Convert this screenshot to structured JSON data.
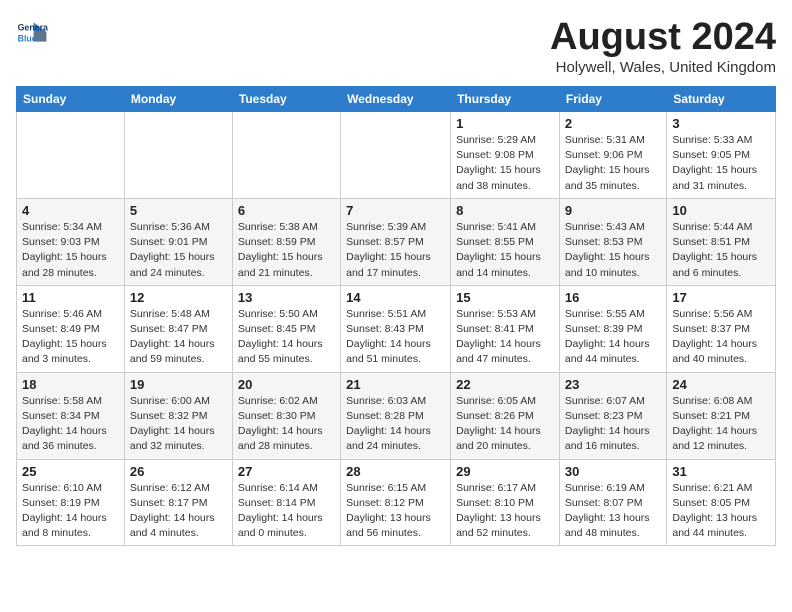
{
  "logo": {
    "line1": "General",
    "line2": "Blue"
  },
  "title": "August 2024",
  "location": "Holywell, Wales, United Kingdom",
  "days_of_week": [
    "Sunday",
    "Monday",
    "Tuesday",
    "Wednesday",
    "Thursday",
    "Friday",
    "Saturday"
  ],
  "weeks": [
    [
      {
        "day": "",
        "info": ""
      },
      {
        "day": "",
        "info": ""
      },
      {
        "day": "",
        "info": ""
      },
      {
        "day": "",
        "info": ""
      },
      {
        "day": "1",
        "info": "Sunrise: 5:29 AM\nSunset: 9:08 PM\nDaylight: 15 hours\nand 38 minutes."
      },
      {
        "day": "2",
        "info": "Sunrise: 5:31 AM\nSunset: 9:06 PM\nDaylight: 15 hours\nand 35 minutes."
      },
      {
        "day": "3",
        "info": "Sunrise: 5:33 AM\nSunset: 9:05 PM\nDaylight: 15 hours\nand 31 minutes."
      }
    ],
    [
      {
        "day": "4",
        "info": "Sunrise: 5:34 AM\nSunset: 9:03 PM\nDaylight: 15 hours\nand 28 minutes."
      },
      {
        "day": "5",
        "info": "Sunrise: 5:36 AM\nSunset: 9:01 PM\nDaylight: 15 hours\nand 24 minutes."
      },
      {
        "day": "6",
        "info": "Sunrise: 5:38 AM\nSunset: 8:59 PM\nDaylight: 15 hours\nand 21 minutes."
      },
      {
        "day": "7",
        "info": "Sunrise: 5:39 AM\nSunset: 8:57 PM\nDaylight: 15 hours\nand 17 minutes."
      },
      {
        "day": "8",
        "info": "Sunrise: 5:41 AM\nSunset: 8:55 PM\nDaylight: 15 hours\nand 14 minutes."
      },
      {
        "day": "9",
        "info": "Sunrise: 5:43 AM\nSunset: 8:53 PM\nDaylight: 15 hours\nand 10 minutes."
      },
      {
        "day": "10",
        "info": "Sunrise: 5:44 AM\nSunset: 8:51 PM\nDaylight: 15 hours\nand 6 minutes."
      }
    ],
    [
      {
        "day": "11",
        "info": "Sunrise: 5:46 AM\nSunset: 8:49 PM\nDaylight: 15 hours\nand 3 minutes."
      },
      {
        "day": "12",
        "info": "Sunrise: 5:48 AM\nSunset: 8:47 PM\nDaylight: 14 hours\nand 59 minutes."
      },
      {
        "day": "13",
        "info": "Sunrise: 5:50 AM\nSunset: 8:45 PM\nDaylight: 14 hours\nand 55 minutes."
      },
      {
        "day": "14",
        "info": "Sunrise: 5:51 AM\nSunset: 8:43 PM\nDaylight: 14 hours\nand 51 minutes."
      },
      {
        "day": "15",
        "info": "Sunrise: 5:53 AM\nSunset: 8:41 PM\nDaylight: 14 hours\nand 47 minutes."
      },
      {
        "day": "16",
        "info": "Sunrise: 5:55 AM\nSunset: 8:39 PM\nDaylight: 14 hours\nand 44 minutes."
      },
      {
        "day": "17",
        "info": "Sunrise: 5:56 AM\nSunset: 8:37 PM\nDaylight: 14 hours\nand 40 minutes."
      }
    ],
    [
      {
        "day": "18",
        "info": "Sunrise: 5:58 AM\nSunset: 8:34 PM\nDaylight: 14 hours\nand 36 minutes."
      },
      {
        "day": "19",
        "info": "Sunrise: 6:00 AM\nSunset: 8:32 PM\nDaylight: 14 hours\nand 32 minutes."
      },
      {
        "day": "20",
        "info": "Sunrise: 6:02 AM\nSunset: 8:30 PM\nDaylight: 14 hours\nand 28 minutes."
      },
      {
        "day": "21",
        "info": "Sunrise: 6:03 AM\nSunset: 8:28 PM\nDaylight: 14 hours\nand 24 minutes."
      },
      {
        "day": "22",
        "info": "Sunrise: 6:05 AM\nSunset: 8:26 PM\nDaylight: 14 hours\nand 20 minutes."
      },
      {
        "day": "23",
        "info": "Sunrise: 6:07 AM\nSunset: 8:23 PM\nDaylight: 14 hours\nand 16 minutes."
      },
      {
        "day": "24",
        "info": "Sunrise: 6:08 AM\nSunset: 8:21 PM\nDaylight: 14 hours\nand 12 minutes."
      }
    ],
    [
      {
        "day": "25",
        "info": "Sunrise: 6:10 AM\nSunset: 8:19 PM\nDaylight: 14 hours\nand 8 minutes."
      },
      {
        "day": "26",
        "info": "Sunrise: 6:12 AM\nSunset: 8:17 PM\nDaylight: 14 hours\nand 4 minutes."
      },
      {
        "day": "27",
        "info": "Sunrise: 6:14 AM\nSunset: 8:14 PM\nDaylight: 14 hours\nand 0 minutes."
      },
      {
        "day": "28",
        "info": "Sunrise: 6:15 AM\nSunset: 8:12 PM\nDaylight: 13 hours\nand 56 minutes."
      },
      {
        "day": "29",
        "info": "Sunrise: 6:17 AM\nSunset: 8:10 PM\nDaylight: 13 hours\nand 52 minutes."
      },
      {
        "day": "30",
        "info": "Sunrise: 6:19 AM\nSunset: 8:07 PM\nDaylight: 13 hours\nand 48 minutes."
      },
      {
        "day": "31",
        "info": "Sunrise: 6:21 AM\nSunset: 8:05 PM\nDaylight: 13 hours\nand 44 minutes."
      }
    ]
  ]
}
